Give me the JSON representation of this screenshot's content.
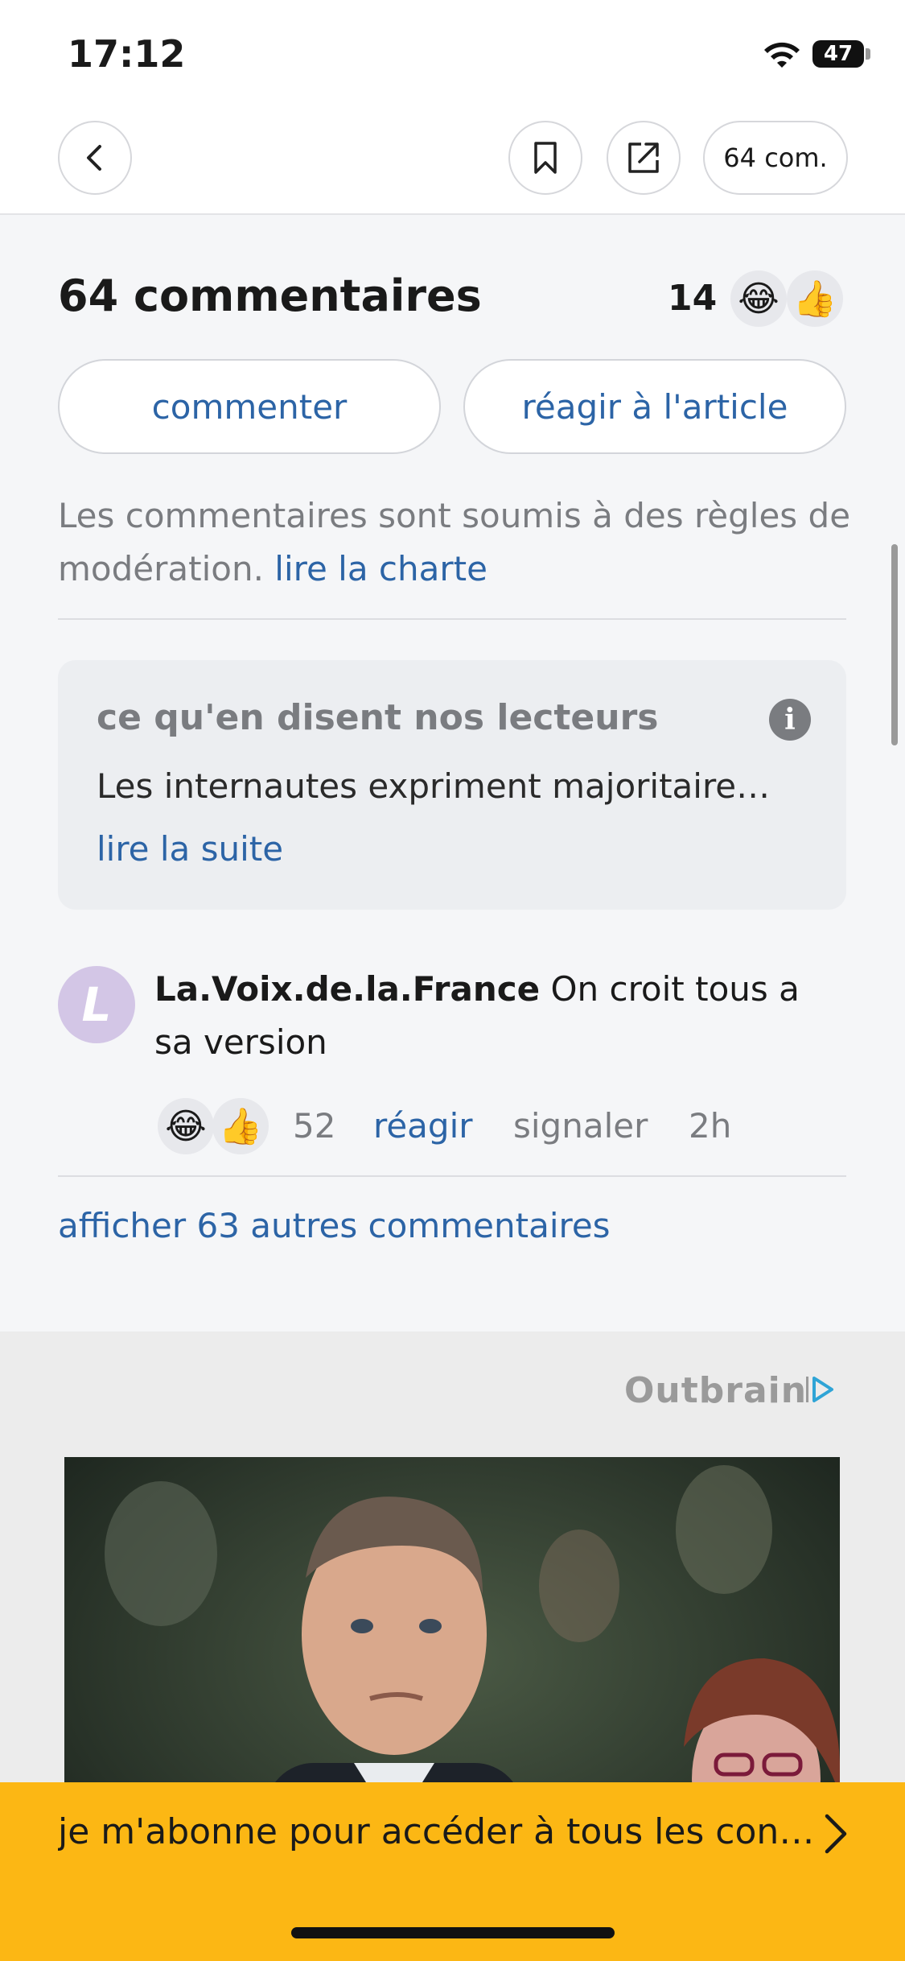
{
  "status_bar": {
    "time": "17:12",
    "battery": "47"
  },
  "nav": {
    "comments_pill": "64 com."
  },
  "comments": {
    "title": "64 commentaires",
    "reaction_count": "14",
    "comment_button": "commenter",
    "react_button": "réagir à l'article",
    "moderation_text": "Les commentaires sont soumis à des règles de modération.",
    "charter_link": "lire la charte"
  },
  "readers_box": {
    "title": "ce qu'en disent nos lecteurs",
    "summary": "Les internautes expriment majoritairem...",
    "read_more": "lire la suite"
  },
  "comment": {
    "avatar_letter": "L",
    "author": "La.Voix.de.la.France",
    "text": "On croit tous a sa version",
    "reaction_count": "52",
    "react_link": "réagir",
    "report_link": "signaler",
    "time": "2h"
  },
  "more_comments": "afficher 63 autres commentaires",
  "outbrain": {
    "logo": "Outbrain"
  },
  "subscribe_bar": {
    "text": "je m'abonne pour accéder à tous les conten..."
  },
  "colors": {
    "accent_blue": "#2c64a6",
    "subscribe_yellow": "#fcb714",
    "muted_gray": "#7a7c80"
  }
}
